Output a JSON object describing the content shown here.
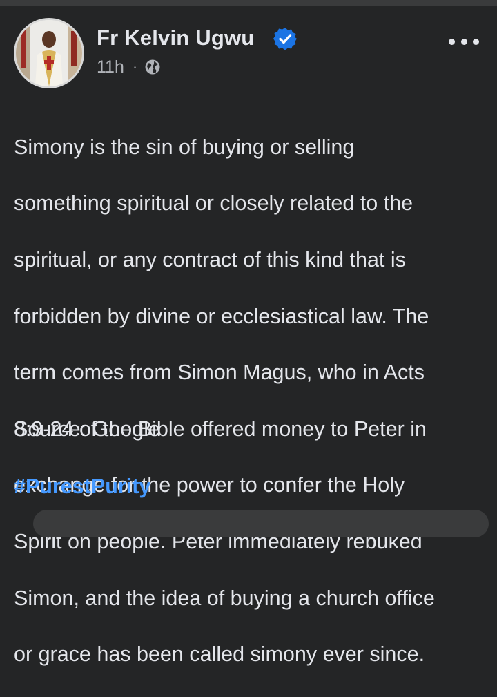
{
  "post": {
    "author": {
      "name": "Fr Kelvin Ugwu",
      "verified": true,
      "avatar_icon": "priest-portrait-avatar"
    },
    "meta": {
      "time": "11h",
      "separator": "·",
      "audience_icon": "globe-icon"
    },
    "menu_icon": "more-options-icon",
    "body_lines": [
      "Simony is the sin of buying or selling",
      "something spiritual or closely related to the",
      "spiritual, or any contract of this kind that is",
      "forbidden by divine or ecclesiastical law. The",
      "term comes from Simon Magus, who in Acts",
      "8:9-24 of the Bible offered money to Peter in",
      "exchange for the power to confer the Holy",
      "Spirit on people. Peter immediately rebuked",
      "Simon, and the idea of buying a church office",
      "or grace has been called simony ever since."
    ],
    "source": "Source: Google",
    "hashtag": "#PurestPurity"
  },
  "colors": {
    "background": "#242526",
    "text": "#e4e6eb",
    "secondary_text": "#b0b3b8",
    "link": "#4599ff",
    "verified_badge": "#1b74e4"
  }
}
